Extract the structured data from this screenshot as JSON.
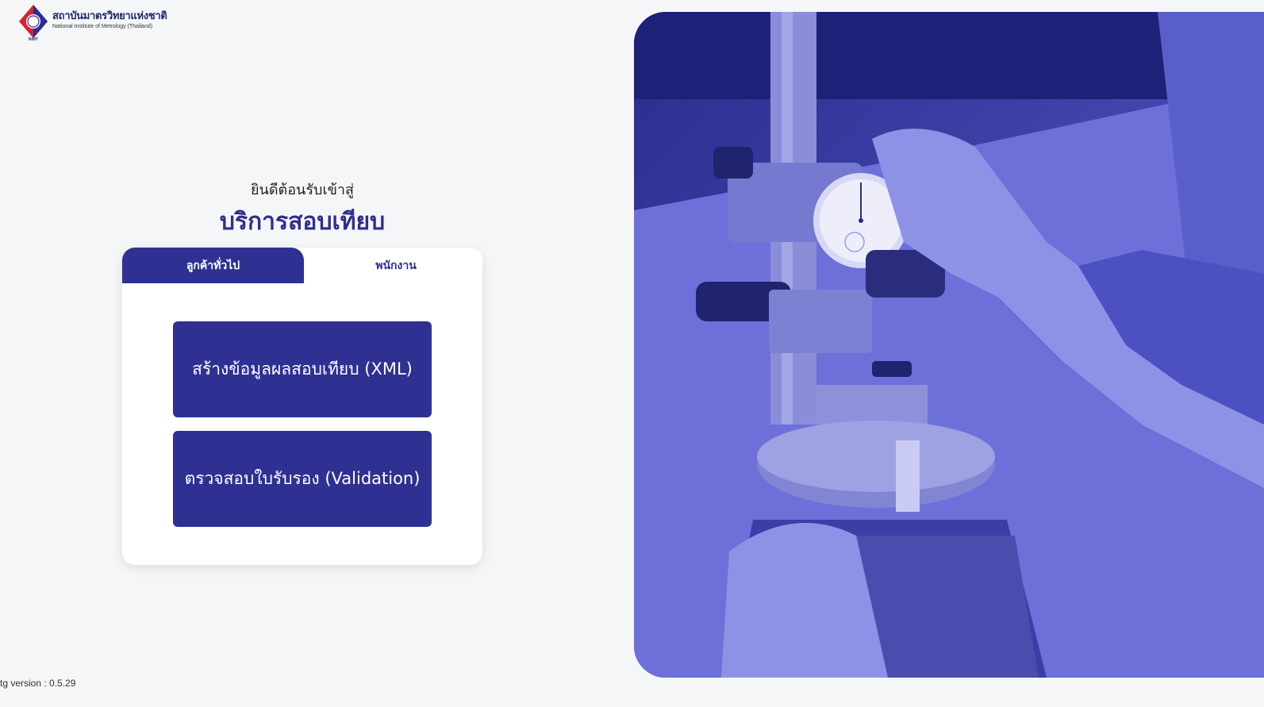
{
  "logo": {
    "name_th": "สถาบันมาตรวิทยาแห่งชาติ",
    "name_en": "National Institute of Metrology (Thailand)",
    "abbrev": "NIMT",
    "seal_text": "มว"
  },
  "hero": {
    "welcome": "ยินดีต้อนรับเข้าสู่",
    "title": "บริการสอบเทียบ"
  },
  "tabs": [
    {
      "label": "ลูกค้าทั่วไป",
      "active": true
    },
    {
      "label": "พนักงาน",
      "active": false
    }
  ],
  "actions": {
    "xml_label": "สร้างข้อมูลผลสอบเทียบ (XML)",
    "validation_label": "ตรวจสอบใบรับรอง (Validation)"
  },
  "footer": {
    "version": "tg version : 0.5.29"
  },
  "colors": {
    "primary": "#2e3192",
    "background": "#f5f6f8",
    "photo_tint": "#4a4fc4",
    "logo_red": "#d7232f"
  },
  "icons": {
    "logo": "nimt-diamond-logo",
    "photo": "dial-indicator-photo"
  }
}
